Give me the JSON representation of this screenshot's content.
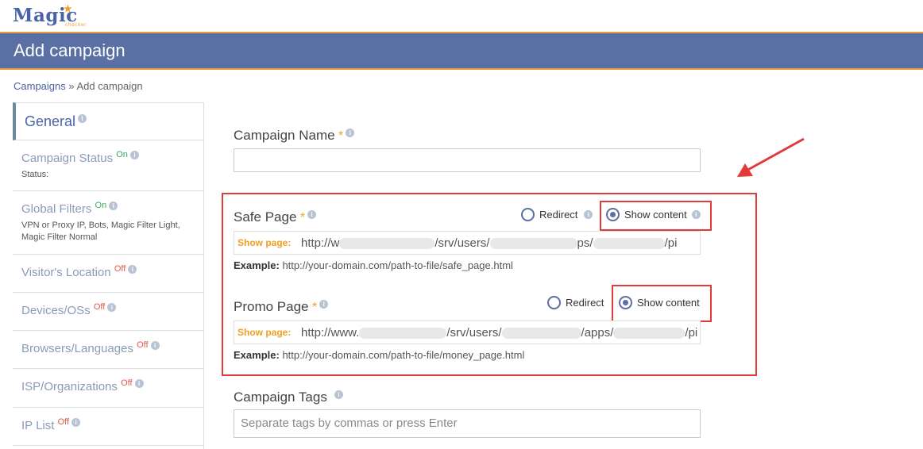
{
  "logo": {
    "text": "Magic",
    "sub": "checker"
  },
  "page": {
    "title": "Add campaign"
  },
  "breadcrumb": {
    "link": "Campaigns",
    "separator": " » ",
    "current": "Add campaign"
  },
  "sidebar": {
    "general": "General",
    "items": [
      {
        "label": "Campaign Status",
        "state": "On",
        "sub": "Status:"
      },
      {
        "label": "Global Filters",
        "state": "On",
        "sub": "VPN or Proxy IP, Bots, Magic Filter Light, Magic Filter Normal"
      },
      {
        "label": "Visitor's Location",
        "state": "Off",
        "sub": ""
      },
      {
        "label": "Devices/OSs",
        "state": "Off",
        "sub": ""
      },
      {
        "label": "Browsers/Languages",
        "state": "Off",
        "sub": ""
      },
      {
        "label": "ISP/Organizations",
        "state": "Off",
        "sub": ""
      },
      {
        "label": "IP List",
        "state": "Off",
        "sub": ""
      }
    ]
  },
  "form": {
    "campaign_name": {
      "label": "Campaign Name",
      "required": "*",
      "value": ""
    },
    "safe_page": {
      "label": "Safe Page",
      "required": "*",
      "radio_redirect": "Redirect",
      "radio_show": "Show content",
      "prefix": "Show page:",
      "url_start": "http://w",
      "url_mid1": "/srv/users/",
      "url_mid2": "ps/",
      "url_end": "/pi",
      "example_label": "Example:",
      "example": "http://your-domain.com/path-to-file/safe_page.html"
    },
    "promo_page": {
      "label": "Promo Page",
      "required": "*",
      "radio_redirect": "Redirect",
      "radio_show": "Show content",
      "prefix": "Show page:",
      "url_start": "http://www.",
      "url_mid1": "/srv/users/",
      "url_mid2": "/apps/",
      "url_end": "/pi",
      "example_label": "Example:",
      "example": "http://your-domain.com/path-to-file/money_page.html"
    },
    "tags": {
      "label": "Campaign Tags",
      "placeholder": "Separate tags by commas or press Enter"
    }
  },
  "colors": {
    "header": "#5a6fa3",
    "accent": "#f0a020",
    "highlight": "#e03a3a"
  }
}
